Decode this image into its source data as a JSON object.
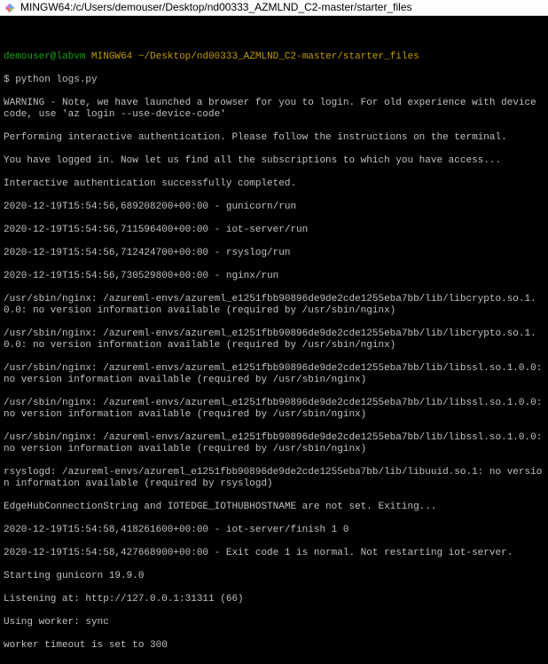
{
  "title": "MINGW64:/c/Users/demouser/Desktop/nd00333_AZMLND_C2-master/starter_files",
  "prompt": {
    "user": "demouser@labvm",
    "shell": "MINGW64",
    "path": "~/Desktop/nd00333_AZMLND_C2-master/starter_files",
    "command": "python logs.py"
  },
  "out": {
    "l1": "WARNING - Note, we have launched a browser for you to login. For old experience with device code, use 'az login --use-device-code'",
    "l2": "Performing interactive authentication. Please follow the instructions on the terminal.",
    "l3": "You have logged in. Now let us find all the subscriptions to which you have access...",
    "l4": "Interactive authentication successfully completed.",
    "l5": "2020-12-19T15:54:56,689208200+00:00 - gunicorn/run",
    "l6": "2020-12-19T15:54:56,711596400+00:00 - iot-server/run",
    "l7": "2020-12-19T15:54:56,712424700+00:00 - rsyslog/run",
    "l8": "2020-12-19T15:54:56,730529800+00:00 - nginx/run",
    "l9": "/usr/sbin/nginx: /azureml-envs/azureml_e1251fbb90896de9de2cde1255eba7bb/lib/libcrypto.so.1.0.0: no version information available (required by /usr/sbin/nginx)",
    "l10": "/usr/sbin/nginx: /azureml-envs/azureml_e1251fbb90896de9de2cde1255eba7bb/lib/libcrypto.so.1.0.0: no version information available (required by /usr/sbin/nginx)",
    "l11": "/usr/sbin/nginx: /azureml-envs/azureml_e1251fbb90896de9de2cde1255eba7bb/lib/libssl.so.1.0.0: no version information available (required by /usr/sbin/nginx)",
    "l12": "/usr/sbin/nginx: /azureml-envs/azureml_e1251fbb90896de9de2cde1255eba7bb/lib/libssl.so.1.0.0: no version information available (required by /usr/sbin/nginx)",
    "l13": "/usr/sbin/nginx: /azureml-envs/azureml_e1251fbb90896de9de2cde1255eba7bb/lib/libssl.so.1.0.0: no version information available (required by /usr/sbin/nginx)",
    "l14": "rsyslogd: /azureml-envs/azureml_e1251fbb90896de9de2cde1255eba7bb/lib/libuuid.so.1: no version information available (required by rsyslogd)",
    "l15": "EdgeHubConnectionString and IOTEDGE_IOTHUBHOSTNAME are not set. Exiting...",
    "l16": "2020-12-19T15:54:58,418261600+00:00 - iot-server/finish 1 0",
    "l17": "2020-12-19T15:54:58,427668900+00:00 - Exit code 1 is normal. Not restarting iot-server.",
    "l18": "Starting gunicorn 19.9.0",
    "l19": "Listening at: http://127.0.0.1:31311 (66)",
    "l20": "Using worker: sync",
    "l21": "worker timeout is set to 300"
  }
}
